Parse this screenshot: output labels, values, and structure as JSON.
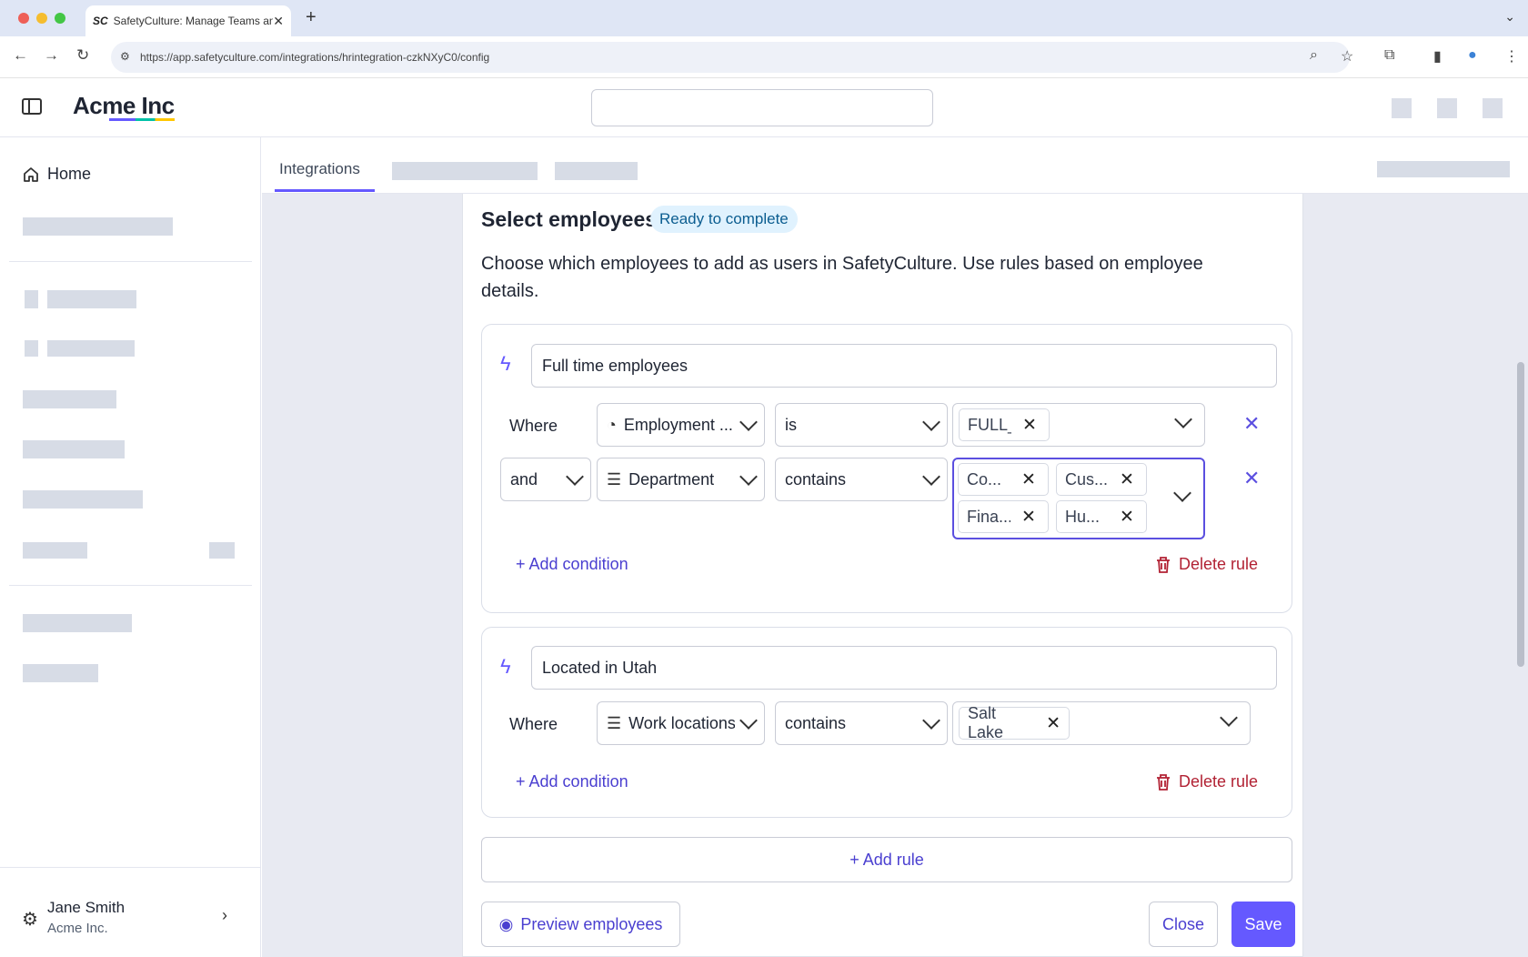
{
  "browser": {
    "tab_title": "SafetyCulture: Manage Teams and...",
    "tab_favicon": "SC",
    "url": "https://app.safetyculture.com/integrations/hrintegration-czkNXyC0/config"
  },
  "app": {
    "logo": "Acme Inc"
  },
  "sidebar": {
    "home_label": "Home",
    "user_name": "Jane Smith",
    "user_org": "Acme Inc."
  },
  "tabs": {
    "active": "Integrations"
  },
  "section": {
    "title": "Select employees",
    "badge": "Ready to complete",
    "description": "Choose which employees to add as users in SafetyCulture. Use rules based on employee details."
  },
  "rules": [
    {
      "name": "Full time employees",
      "conditions": [
        {
          "prefix": "Where",
          "field": "Employment ...",
          "field_icon": "status-icon",
          "operator": "is",
          "values": [
            "FULL_T"
          ]
        },
        {
          "prefix": "and",
          "field": "Department",
          "field_icon": "list-icon",
          "operator": "contains",
          "values": [
            "Co...",
            "Cus...",
            "Fina...",
            "Hu..."
          ]
        }
      ],
      "add_condition": "Add condition",
      "delete_rule": "Delete rule"
    },
    {
      "name": "Located in Utah",
      "conditions": [
        {
          "prefix": "Where",
          "field": "Work locations",
          "field_icon": "list-icon",
          "operator": "contains",
          "values": [
            "Salt Lake"
          ]
        }
      ],
      "add_condition": "Add condition",
      "delete_rule": "Delete rule"
    }
  ],
  "actions": {
    "add_rule": "Add rule",
    "preview": "Preview employees",
    "close": "Close",
    "save": "Save"
  },
  "colors": {
    "accent": "#6559ff",
    "danger": "#b22234",
    "badge_bg": "#e0f2fe"
  }
}
